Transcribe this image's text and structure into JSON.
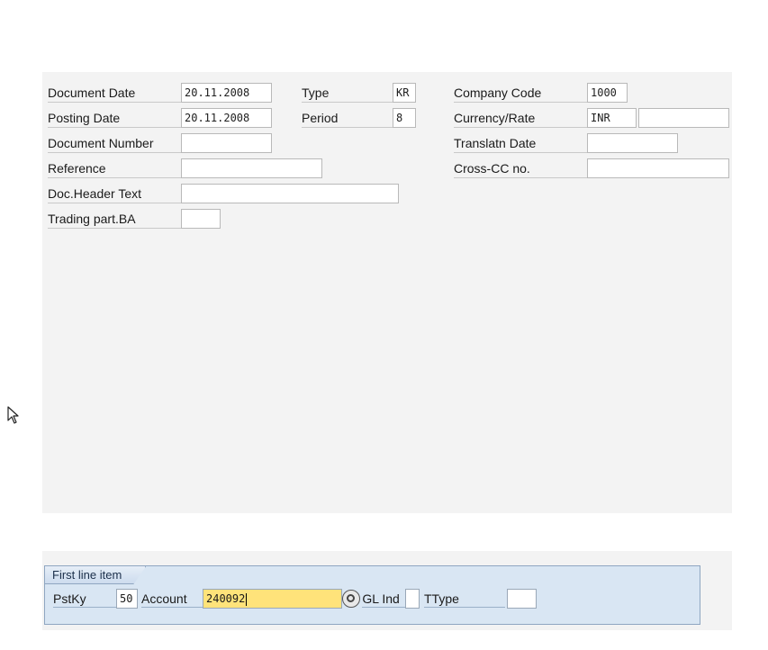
{
  "header": {
    "document_date": {
      "label": "Document Date",
      "value": "20.11.2008"
    },
    "posting_date": {
      "label": "Posting Date",
      "value": "20.11.2008"
    },
    "document_number": {
      "label": "Document Number",
      "value": ""
    },
    "reference": {
      "label": "Reference",
      "value": ""
    },
    "doc_header_text": {
      "label": "Doc.Header Text",
      "value": ""
    },
    "trading_part_ba": {
      "label": "Trading part.BA",
      "value": ""
    },
    "type": {
      "label": "Type",
      "value": "KR"
    },
    "period": {
      "label": "Period",
      "value": "8"
    },
    "company_code": {
      "label": "Company Code",
      "value": "1000"
    },
    "currency_rate": {
      "label": "Currency/Rate",
      "currency": "INR",
      "rate": ""
    },
    "translation_date": {
      "label": "Translatn Date",
      "value": ""
    },
    "cross_cc_no": {
      "label": "Cross-CC no.",
      "value": ""
    }
  },
  "first_line_item": {
    "title": "First line item",
    "pstky": {
      "label": "PstKy",
      "value": "50"
    },
    "account": {
      "label": "Account",
      "value": "240092"
    },
    "sgl_ind": {
      "label": "SGL Ind",
      "value": ""
    },
    "ttype": {
      "label": "TType",
      "value": ""
    }
  },
  "icons": {
    "match_code": "search-help-icon",
    "mouse_cursor": "mouse-pointer-icon"
  },
  "colors": {
    "panel": "#f3f3f3",
    "group_bg": "#d9e6f3",
    "focus_field": "#ffe37a"
  }
}
